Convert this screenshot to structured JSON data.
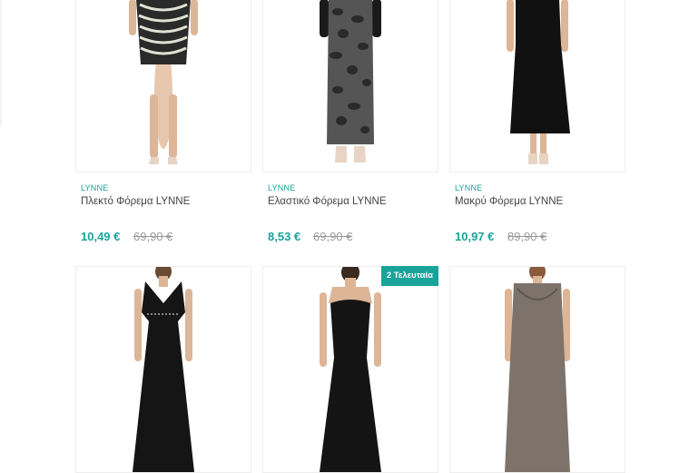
{
  "products": [
    {
      "brand": "LYNNE",
      "title": "Πλεκτό Φόρεμα LYNNE",
      "price": "10,49 €",
      "old_price": "69,90 €",
      "dress_color": "#2a2a2a",
      "pattern": "zebra",
      "image": "knit-dress-photo"
    },
    {
      "brand": "LYNNE",
      "title": "Ελαστικό Φόρεμα LYNNE",
      "price": "8,53 €",
      "old_price": "69,90 €",
      "dress_color": "#555555",
      "pattern": "leopard",
      "image": "stretch-dress-photo"
    },
    {
      "brand": "LYNNE",
      "title": "Μακρύ Φόρεμα LYNNE",
      "price": "10,97 €",
      "old_price": "89,90 €",
      "dress_color": "#111111",
      "pattern": "solid",
      "image": "long-dress-photo"
    },
    {
      "badge": "",
      "dress_color": "#151515",
      "pattern": "v-neck",
      "image": "black-gown-photo"
    },
    {
      "badge": "2 Τελευταία",
      "dress_color": "#141414",
      "pattern": "strapless",
      "image": "strapless-gown-photo"
    },
    {
      "badge": "",
      "dress_color": "#7d736a",
      "pattern": "cowl",
      "image": "taupe-gown-photo"
    }
  ],
  "colors": {
    "accent": "#1aa39a",
    "old_price": "#9a9a9a",
    "border": "#eeeeee"
  }
}
